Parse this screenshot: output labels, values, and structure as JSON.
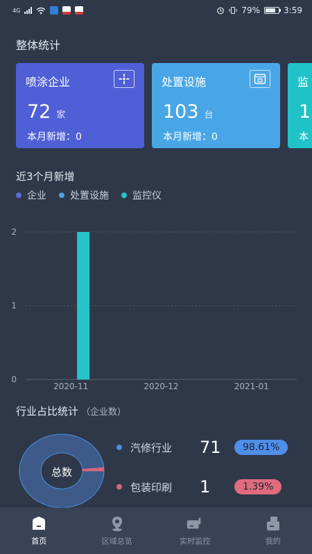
{
  "status_bar": {
    "network": "4G",
    "battery": "79%",
    "time": "3:59",
    "battery_level": 0.79
  },
  "overall": {
    "title": "整体统计",
    "cards": [
      {
        "title": "喷涂企业",
        "value": "72",
        "unit": "家",
        "month_label": "本月新增：0",
        "color": "#4f5fd6",
        "icon": "fan-icon"
      },
      {
        "title": "处置设施",
        "value": "103",
        "unit": "台",
        "month_label": "本月新增：0",
        "color": "#49a6e6",
        "icon": "device-icon"
      },
      {
        "title": "监",
        "value": "1",
        "unit": "",
        "month_label": "本",
        "color": "#1fc2c7",
        "icon": ""
      }
    ]
  },
  "recent": {
    "title": "近3个月新增",
    "legend": [
      {
        "name": "企业",
        "color": "#5a6bd9"
      },
      {
        "name": "处置设施",
        "color": "#4aa3e0"
      },
      {
        "name": "监控仪",
        "color": "#28c3ca"
      }
    ]
  },
  "chart_data": {
    "type": "bar",
    "categories": [
      "2020-11",
      "2020-12",
      "2021-01"
    ],
    "series": [
      {
        "name": "企业",
        "values": [
          0,
          0,
          0
        ],
        "color": "#5a6bd9"
      },
      {
        "name": "处置设施",
        "values": [
          0,
          0,
          0
        ],
        "color": "#4aa3e0"
      },
      {
        "name": "监控仪",
        "values": [
          2,
          0,
          0
        ],
        "color": "#28c3ca"
      }
    ],
    "yticks": [
      "0",
      "1",
      "2"
    ],
    "ylim": [
      0,
      2
    ],
    "grid": true,
    "legend_position": "top-left"
  },
  "industry": {
    "title": "行业占比统计",
    "subtitle": "（企业数）",
    "center_label": "总数",
    "items": [
      {
        "name": "汽修行业",
        "count": "71",
        "percent": "98.61%",
        "share": 0.9861,
        "color": "#4a90e2",
        "badge_color": "#4f8fe8"
      },
      {
        "name": "包装印刷",
        "count": "1",
        "percent": "1.39%",
        "share": 0.0139,
        "color": "#d9677a",
        "badge_color": "#e06b7d"
      }
    ]
  },
  "tabbar": {
    "tabs": [
      {
        "label": "首页",
        "icon": "home-icon",
        "active": true
      },
      {
        "label": "区域总览",
        "icon": "location-icon",
        "active": false
      },
      {
        "label": "实时监控",
        "icon": "camera-icon",
        "active": false
      },
      {
        "label": "我的",
        "icon": "user-icon",
        "active": false
      }
    ]
  }
}
